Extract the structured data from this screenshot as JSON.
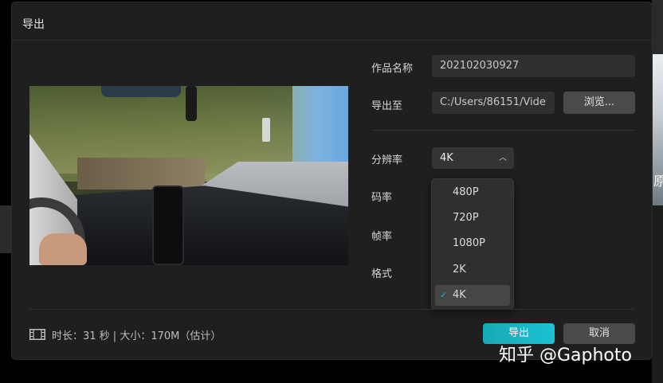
{
  "dialog": {
    "title": "导出",
    "form": {
      "name_label": "作品名称",
      "name_value": "202102030927",
      "path_label": "导出至",
      "path_value": "C:/Users/86151/Vide",
      "browse_label": "浏览...",
      "resolution_label": "分辨率",
      "resolution_value": "4K",
      "bitrate_label": "码率",
      "framerate_label": "帧率",
      "format_label": "格式"
    },
    "dropdown": {
      "options": [
        {
          "label": "480P",
          "selected": false
        },
        {
          "label": "720P",
          "selected": false
        },
        {
          "label": "1080P",
          "selected": false
        },
        {
          "label": "2K",
          "selected": false
        },
        {
          "label": "4K",
          "selected": true
        }
      ]
    },
    "footer": {
      "info": "时长：31 秒 | 大小：170M（估计）",
      "export_label": "导出",
      "cancel_label": "取消"
    }
  },
  "background": {
    "right_glyph": "原"
  },
  "watermark": {
    "text": "知乎 @Gaphoto"
  },
  "colors": {
    "accent": "#19b6c9",
    "dialog_bg": "#1f1f1f",
    "field_bg": "#303030"
  }
}
